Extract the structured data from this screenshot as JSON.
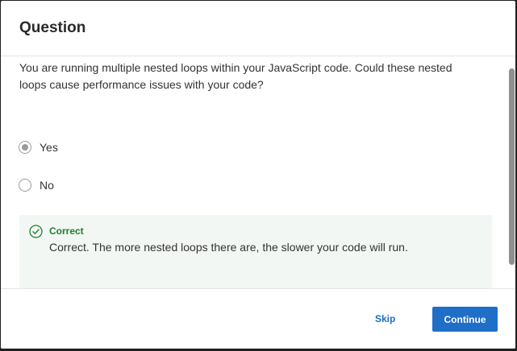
{
  "dialog": {
    "title": "Question",
    "question": "You are running multiple nested loops within your JavaScript code. Could these nested loops cause performance issues with your code?",
    "options": [
      {
        "label": "Yes",
        "selected": true
      },
      {
        "label": "No",
        "selected": false
      }
    ],
    "feedback": {
      "icon": "check-circle-icon",
      "title": "Correct",
      "text": "Correct. The more nested loops there are, the slower your code will run."
    },
    "footer": {
      "skip_label": "Skip",
      "continue_label": "Continue"
    }
  },
  "colors": {
    "accent": "#1f6fc9",
    "link": "#1c6bc4",
    "success": "#1e7d32",
    "feedback_bg": "#f3f7f3"
  }
}
